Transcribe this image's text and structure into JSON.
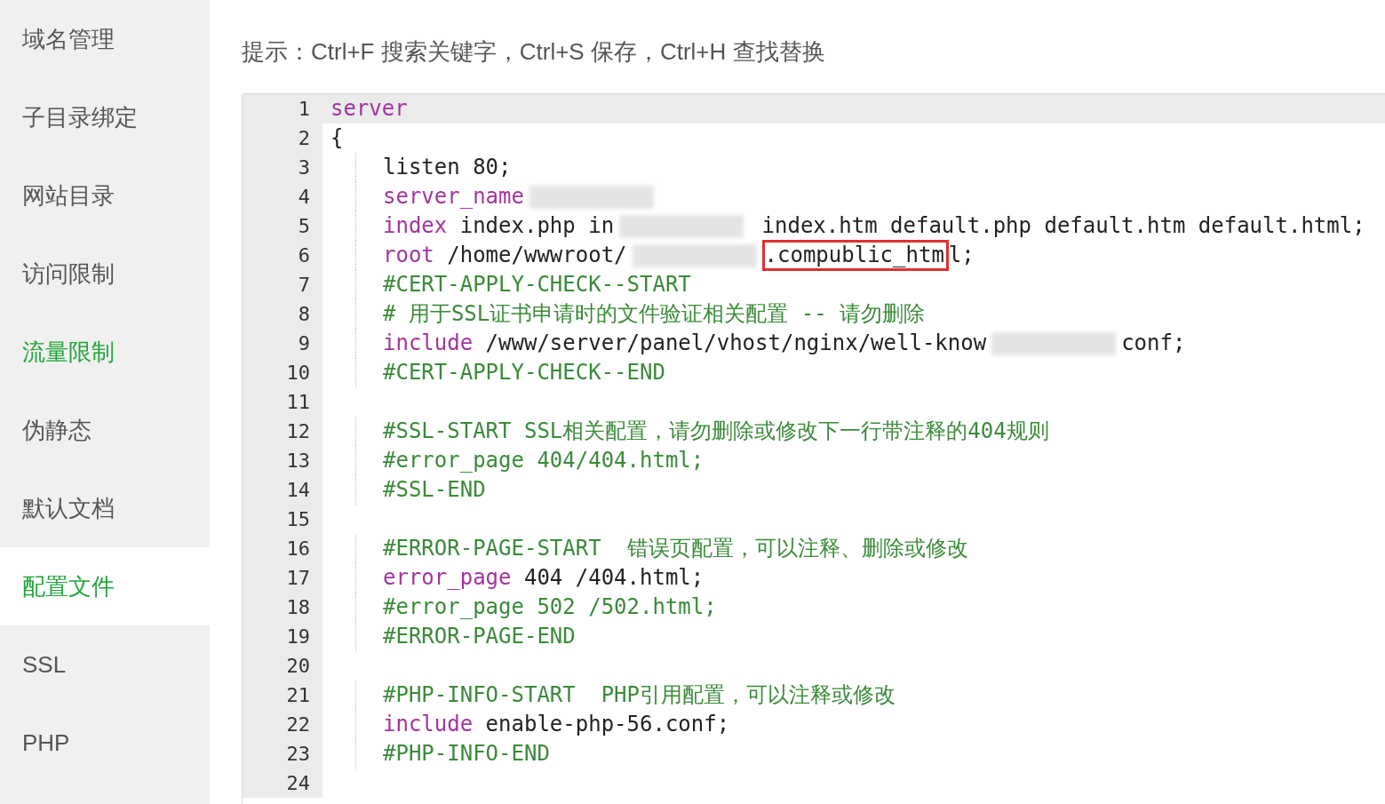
{
  "sidebar": {
    "items": [
      {
        "label": "域名管理",
        "selected": false,
        "hover": false
      },
      {
        "label": "子目录绑定",
        "selected": false,
        "hover": false
      },
      {
        "label": "网站目录",
        "selected": false,
        "hover": false
      },
      {
        "label": "访问限制",
        "selected": false,
        "hover": false
      },
      {
        "label": "流量限制",
        "selected": false,
        "hover": true
      },
      {
        "label": "伪静态",
        "selected": false,
        "hover": false
      },
      {
        "label": "默认文档",
        "selected": false,
        "hover": false
      },
      {
        "label": "配置文件",
        "selected": true,
        "hover": false
      },
      {
        "label": "SSL",
        "selected": false,
        "hover": false
      },
      {
        "label": "PHP",
        "selected": false,
        "hover": false
      }
    ]
  },
  "hint": "提示：Ctrl+F 搜索关键字，Ctrl+S 保存，Ctrl+H 查找替换",
  "editor": {
    "lines": [
      {
        "number": "1",
        "active": true,
        "indented": false,
        "tokens": [
          {
            "kind": "keyword",
            "text": "server"
          }
        ]
      },
      {
        "number": "2",
        "active": false,
        "indented": false,
        "tokens": [
          {
            "kind": "plain",
            "text": "{"
          }
        ]
      },
      {
        "number": "3",
        "active": false,
        "indented": true,
        "tokens": [
          {
            "kind": "plain",
            "text": "listen 80;"
          }
        ]
      },
      {
        "number": "4",
        "active": false,
        "indented": true,
        "tokens": [
          {
            "kind": "keyword",
            "text": "server_name"
          },
          {
            "kind": "redacted"
          }
        ]
      },
      {
        "number": "5",
        "active": false,
        "indented": true,
        "tokens": [
          {
            "kind": "keyword",
            "text": "index"
          },
          {
            "kind": "plain",
            "text": " index.php in"
          },
          {
            "kind": "redacted"
          },
          {
            "kind": "plain",
            "text": " index.htm default.php default.htm default.html;"
          }
        ]
      },
      {
        "number": "6",
        "active": false,
        "indented": true,
        "tokens": [
          {
            "kind": "keyword",
            "text": "root"
          },
          {
            "kind": "plain",
            "text": " /home/wwwroot/"
          },
          {
            "kind": "redacted"
          },
          {
            "kind": "boxed",
            "text": ".compublic_htm"
          },
          {
            "kind": "plain",
            "text": "l;"
          }
        ]
      },
      {
        "number": "7",
        "active": false,
        "indented": true,
        "tokens": [
          {
            "kind": "comment",
            "text": "#CERT-APPLY-CHECK--START"
          }
        ]
      },
      {
        "number": "8",
        "active": false,
        "indented": true,
        "tokens": [
          {
            "kind": "comment",
            "text": "# 用于SSL证书申请时的文件验证相关配置 -- 请勿删除"
          }
        ]
      },
      {
        "number": "9",
        "active": false,
        "indented": true,
        "tokens": [
          {
            "kind": "keyword",
            "text": "include"
          },
          {
            "kind": "plain",
            "text": " /www/server/panel/vhost/nginx/well-know"
          },
          {
            "kind": "redacted"
          },
          {
            "kind": "plain",
            "text": "conf;"
          }
        ]
      },
      {
        "number": "10",
        "active": false,
        "indented": true,
        "tokens": [
          {
            "kind": "comment",
            "text": "#CERT-APPLY-CHECK--END"
          }
        ]
      },
      {
        "number": "11",
        "active": false,
        "indented": false
      },
      {
        "number": "12",
        "active": false,
        "indented": true,
        "tokens": [
          {
            "kind": "comment",
            "text": "#SSL-START SSL相关配置，请勿删除或修改下一行带注释的404规则"
          }
        ]
      },
      {
        "number": "13",
        "active": false,
        "indented": true,
        "tokens": [
          {
            "kind": "comment",
            "text": "#error_page 404/404.html;"
          }
        ]
      },
      {
        "number": "14",
        "active": false,
        "indented": true,
        "tokens": [
          {
            "kind": "comment",
            "text": "#SSL-END"
          }
        ]
      },
      {
        "number": "15",
        "active": false,
        "indented": false
      },
      {
        "number": "16",
        "active": false,
        "indented": true,
        "tokens": [
          {
            "kind": "comment",
            "text": "#ERROR-PAGE-START  错误页配置，可以注释、删除或修改"
          }
        ]
      },
      {
        "number": "17",
        "active": false,
        "indented": true,
        "tokens": [
          {
            "kind": "keyword",
            "text": "error_page"
          },
          {
            "kind": "plain",
            "text": " 404 /404.html;"
          }
        ]
      },
      {
        "number": "18",
        "active": false,
        "indented": true,
        "tokens": [
          {
            "kind": "comment",
            "text": "#error_page 502 /502.html;"
          }
        ]
      },
      {
        "number": "19",
        "active": false,
        "indented": true,
        "tokens": [
          {
            "kind": "comment",
            "text": "#ERROR-PAGE-END"
          }
        ]
      },
      {
        "number": "20",
        "active": false,
        "indented": false
      },
      {
        "number": "21",
        "active": false,
        "indented": true,
        "tokens": [
          {
            "kind": "comment",
            "text": "#PHP-INFO-START  PHP引用配置，可以注释或修改"
          }
        ]
      },
      {
        "number": "22",
        "active": false,
        "indented": true,
        "tokens": [
          {
            "kind": "keyword",
            "text": "include"
          },
          {
            "kind": "plain",
            "text": " enable-php-56.conf;"
          }
        ]
      },
      {
        "number": "23",
        "active": false,
        "indented": true,
        "tokens": [
          {
            "kind": "comment",
            "text": "#PHP-INFO-END"
          }
        ]
      },
      {
        "number": "24",
        "active": false,
        "indented": false
      }
    ]
  }
}
